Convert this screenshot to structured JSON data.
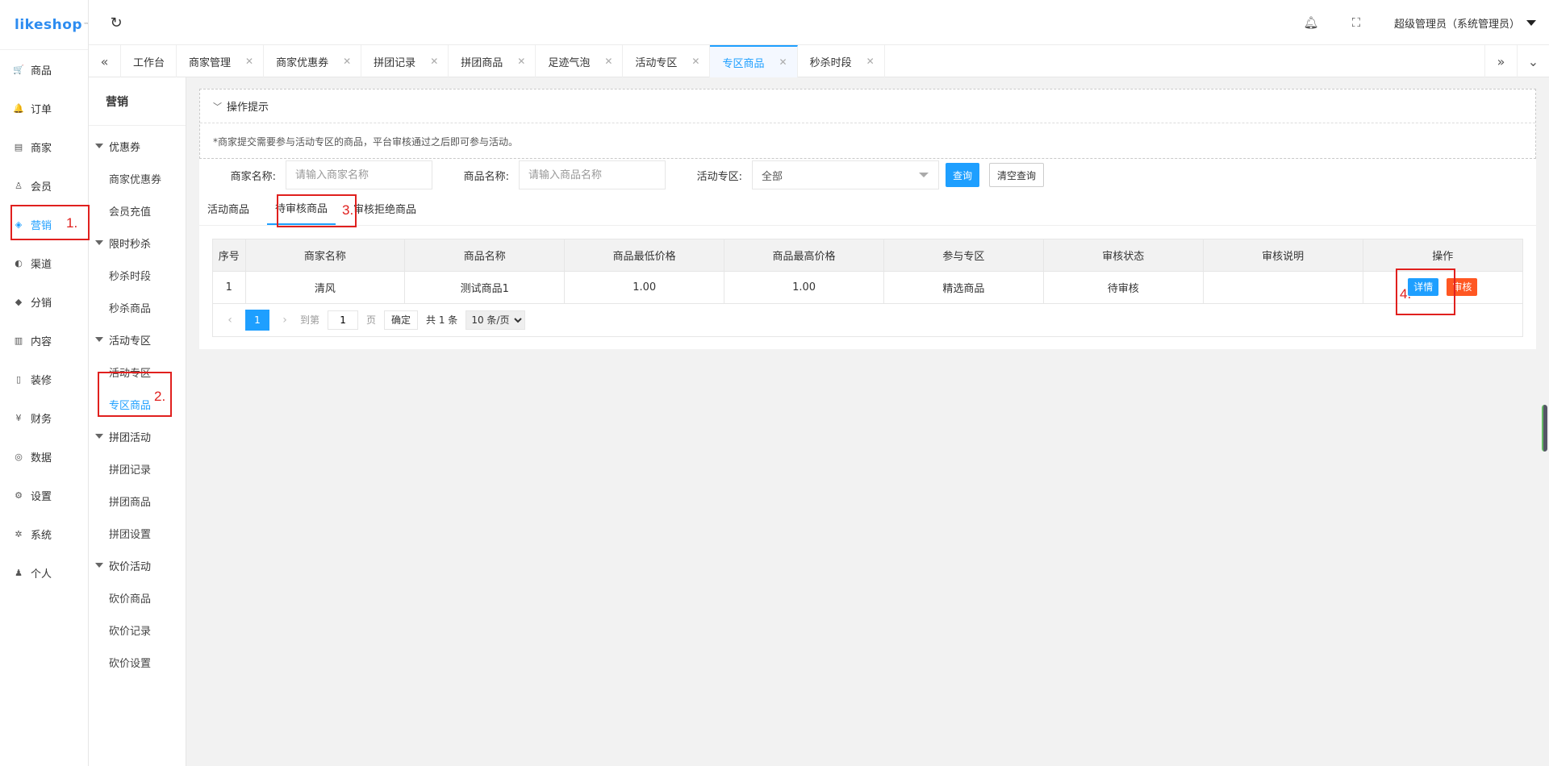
{
  "app": {
    "logo": "likeshop",
    "logo_tm": "™"
  },
  "sidebar": {
    "items": [
      {
        "label": "商品",
        "icon": "cart-icon",
        "glyph": "🛒"
      },
      {
        "label": "订单",
        "icon": "bell-icon",
        "glyph": "🔔"
      },
      {
        "label": "商家",
        "icon": "store-icon",
        "glyph": "▤"
      },
      {
        "label": "会员",
        "icon": "user-icon",
        "glyph": "♙"
      },
      {
        "label": "营销",
        "icon": "marketing-icon",
        "glyph": "◈"
      },
      {
        "label": "渠道",
        "icon": "channel-icon",
        "glyph": "◐"
      },
      {
        "label": "分销",
        "icon": "distribution-icon",
        "glyph": "◆"
      },
      {
        "label": "内容",
        "icon": "book-icon",
        "glyph": "▥"
      },
      {
        "label": "装修",
        "icon": "device-icon",
        "glyph": "▯"
      },
      {
        "label": "财务",
        "icon": "finance-icon",
        "glyph": "¥"
      },
      {
        "label": "数据",
        "icon": "data-icon",
        "glyph": "◎"
      },
      {
        "label": "设置",
        "icon": "gear-icon",
        "glyph": "⚙"
      },
      {
        "label": "系统",
        "icon": "system-icon",
        "glyph": "✲"
      },
      {
        "label": "个人",
        "icon": "person-icon",
        "glyph": "♟"
      }
    ],
    "active_index": 4
  },
  "header": {
    "user": "超级管理员（系统管理员）"
  },
  "tabs": [
    {
      "label": "工作台",
      "closable": false
    },
    {
      "label": "商家管理",
      "closable": true
    },
    {
      "label": "商家优惠券",
      "closable": true
    },
    {
      "label": "拼团记录",
      "closable": true
    },
    {
      "label": "拼团商品",
      "closable": true
    },
    {
      "label": "足迹气泡",
      "closable": true
    },
    {
      "label": "活动专区",
      "closable": true
    },
    {
      "label": "专区商品",
      "closable": true,
      "active": true
    },
    {
      "label": "秒杀时段",
      "closable": true
    }
  ],
  "submenu": {
    "title": "营销",
    "groups": [
      {
        "label": "优惠券",
        "items": [
          "商家优惠券",
          "会员充值"
        ]
      },
      {
        "label": "限时秒杀",
        "items": [
          "秒杀时段",
          "秒杀商品"
        ]
      },
      {
        "label": "活动专区",
        "items": [
          "活动专区",
          "专区商品"
        ]
      },
      {
        "label": "拼团活动",
        "items": [
          "拼团记录",
          "拼团商品",
          "拼团设置"
        ]
      },
      {
        "label": "砍价活动",
        "items": [
          "砍价商品",
          "砍价记录",
          "砍价设置"
        ]
      }
    ],
    "active_item": "专区商品"
  },
  "tips": {
    "title": "操作提示",
    "text": "*商家提交需要参与活动专区的商品，平台审核通过之后即可参与活动。"
  },
  "search": {
    "shop_label": "商家名称:",
    "shop_placeholder": "请输入商家名称",
    "goods_label": "商品名称:",
    "goods_placeholder": "请输入商品名称",
    "area_label": "活动专区:",
    "area_value": "全部",
    "query": "查询",
    "clear": "清空查询"
  },
  "subtabs": [
    "活动商品",
    "待审核商品",
    "审核拒绝商品"
  ],
  "table": {
    "headers": [
      "序号",
      "商家名称",
      "商品名称",
      "商品最低价格",
      "商品最高价格",
      "参与专区",
      "审核状态",
      "审核说明",
      "操作"
    ],
    "rows": [
      [
        "1",
        "清风",
        "测试商品1",
        "1.00",
        "1.00",
        "精选商品",
        "待审核",
        ""
      ]
    ],
    "actions": {
      "detail": "详情",
      "audit": "审核"
    }
  },
  "pager": {
    "current": "1",
    "goto": "到第",
    "page_value": "1",
    "page_unit": "页",
    "confirm": "确定",
    "total": "共 1 条",
    "size": "10 条/页"
  },
  "annotations": [
    "1.",
    "2.",
    "3.",
    "4."
  ],
  "colors": {
    "accent": "#1e9fff",
    "danger": "#ff5722",
    "annotation": "#e0201e"
  }
}
